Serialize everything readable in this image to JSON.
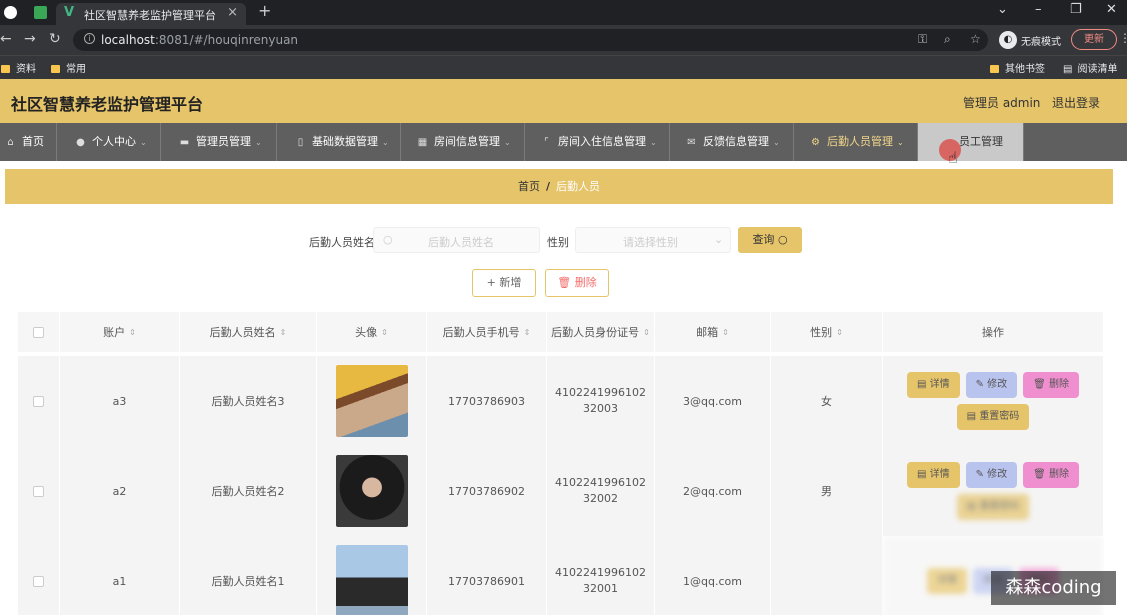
{
  "browser": {
    "tab_title": "社区智慧养老监护管理平台",
    "url_host": "localhost",
    "url_rest": ":8081/#/houqinrenyuan",
    "incognito_label": "无痕模式",
    "update_label": "更新",
    "bookmarks": [
      "资料",
      "常用"
    ],
    "bookmarks_right": [
      "其他书签",
      "阅读清单"
    ]
  },
  "header": {
    "title": "社区智慧养老监护管理平台",
    "user": "管理员 admin",
    "logout": "退出登录"
  },
  "nav": [
    {
      "label": "首页",
      "icon": "home-icon"
    },
    {
      "label": "个人中心",
      "icon": "user-icon"
    },
    {
      "label": "管理员管理",
      "icon": "admin-icon"
    },
    {
      "label": "基础数据管理",
      "icon": "database-icon"
    },
    {
      "label": "房间信息管理",
      "icon": "grid-icon"
    },
    {
      "label": "房间入住信息管理",
      "icon": "crop-icon"
    },
    {
      "label": "反馈信息管理",
      "icon": "feedback-icon"
    },
    {
      "label": "后勤人员管理",
      "icon": "gear-icon"
    },
    {
      "label": "员工管理",
      "icon": "staff-icon"
    }
  ],
  "breadcrumb": {
    "home": "首页",
    "sep": "/",
    "current": "后勤人员"
  },
  "search": {
    "name_label": "后勤人员姓名",
    "name_placeholder": "后勤人员姓名",
    "gender_label": "性别",
    "gender_placeholder": "请选择性别",
    "query_label": "查询"
  },
  "actions": {
    "add": "+ 新增",
    "delete": "删除"
  },
  "table": {
    "columns": [
      "账户",
      "后勤人员姓名",
      "头像",
      "后勤人员手机号",
      "后勤人员身份证号",
      "邮箱",
      "性别",
      "操作"
    ],
    "rows": [
      {
        "account": "a3",
        "name": "后勤人员姓名3",
        "phone": "17703786903",
        "idcard": "410224199610232003",
        "email": "3@qq.com",
        "gender": "女"
      },
      {
        "account": "a2",
        "name": "后勤人员姓名2",
        "phone": "17703786902",
        "idcard": "410224199610232002",
        "email": "2@qq.com",
        "gender": "男"
      },
      {
        "account": "a1",
        "name": "后勤人员姓名1",
        "phone": "17703786901",
        "idcard": "410224199610232001",
        "email": "1@qq.com",
        "gender": ""
      }
    ],
    "op_labels": {
      "detail": "详情",
      "edit": "修改",
      "delete": "删除",
      "reset": "重置密码"
    }
  },
  "watermark": "森森coding",
  "colors": {
    "theme": "#e6c46a",
    "nav_bg": "#5f5f5f",
    "edit": "#b9c4ee",
    "delete": "#f08fcf"
  }
}
